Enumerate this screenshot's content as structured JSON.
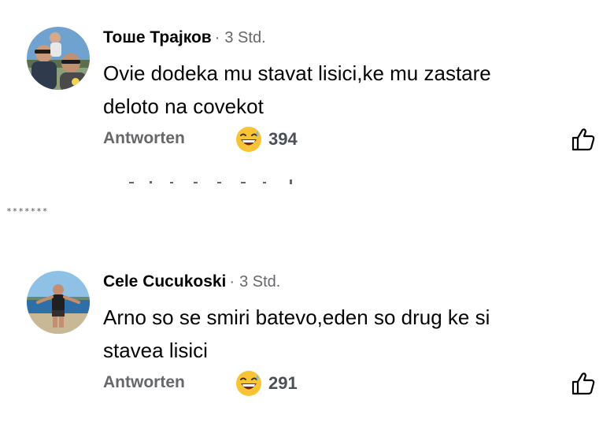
{
  "comments": [
    {
      "author": "Тоше Трајков",
      "time": "3 Std.",
      "text_line1": "Ovie dodeka mu stavat lisici,ke mu zastare",
      "text_line2": "deloto na covekot",
      "reply_label": "Antworten",
      "reaction_icon": "grinning-sweat-emoji",
      "reaction_count": "394",
      "like_icon": "thumbs-up-outline-icon"
    },
    {
      "author": "Cele Cucukoski",
      "time": "3 Std.",
      "text_line1": "Arno so se smiri batevo,eden so drug ke si",
      "text_line2": "stavea lisici",
      "reply_label": "Antworten",
      "reaction_icon": "grinning-sweat-emoji",
      "reaction_count": "291",
      "like_icon": "thumbs-up-outline-icon"
    }
  ],
  "separator": "*******",
  "separator_dot": "·",
  "colors": {
    "text_primary": "#050505",
    "text_secondary": "#65676b",
    "emoji_yellow": "#f7c436"
  }
}
